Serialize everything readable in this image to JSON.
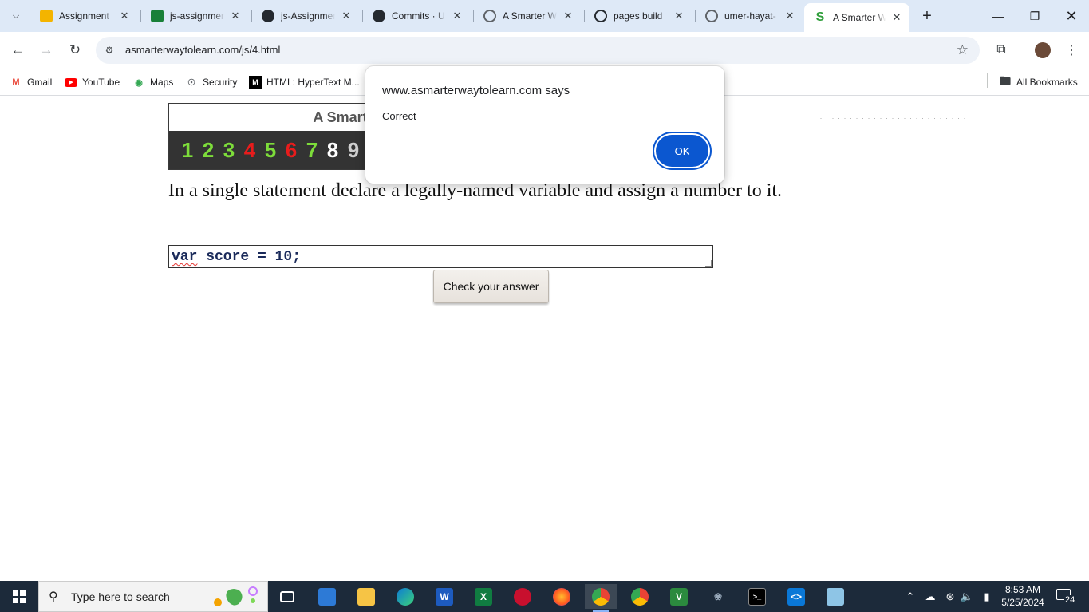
{
  "browser": {
    "tabs": [
      {
        "title": "Assignment",
        "icon": "google-slides-icon",
        "icon_color": "#f4b400",
        "active": false
      },
      {
        "title": "js-assignment",
        "icon": "google-sheets-icon",
        "icon_color": "#188038",
        "active": false
      },
      {
        "title": "js-Assignment",
        "icon": "github-icon",
        "icon_color": "#24292f",
        "active": false
      },
      {
        "title": "Commits · U",
        "icon": "github-icon",
        "icon_color": "#24292f",
        "active": false
      },
      {
        "title": "A Smarter W",
        "icon": "globe-icon",
        "icon_color": "#5f6368",
        "active": false
      },
      {
        "title": "pages build",
        "icon": "github-actions-icon",
        "icon_color": "#24292f",
        "active": false
      },
      {
        "title": "umer-hayat-",
        "icon": "globe-icon",
        "icon_color": "#5f6368",
        "active": false
      },
      {
        "title": "A Smarter W",
        "icon": "s-logo-icon",
        "icon_color": "#2e9e3a",
        "active": true
      }
    ],
    "address": "asmarterwaytolearn.com/js/4.html",
    "bookmarks": [
      {
        "label": "Gmail",
        "icon": "gmail-icon"
      },
      {
        "label": "YouTube",
        "icon": "youtube-icon"
      },
      {
        "label": "Maps",
        "icon": "maps-icon"
      },
      {
        "label": "Security",
        "icon": "globe-icon"
      },
      {
        "label": "HTML: HyperText M...",
        "icon": "mdn-icon"
      }
    ],
    "all_bookmarks": "All Bookmarks"
  },
  "page": {
    "site_title": "A Smarter W",
    "numbers": [
      {
        "n": "1",
        "color": "#7ddc3a"
      },
      {
        "n": "2",
        "color": "#7ddc3a"
      },
      {
        "n": "3",
        "color": "#7ddc3a"
      },
      {
        "n": "4",
        "color": "#e81c1c"
      },
      {
        "n": "5",
        "color": "#7ddc3a"
      },
      {
        "n": "6",
        "color": "#e81c1c"
      },
      {
        "n": "7",
        "color": "#7ddc3a"
      },
      {
        "n": "8",
        "color": "#ffffff"
      },
      {
        "n": "9",
        "color": "#cfcfcf"
      }
    ],
    "instruction": "In a single statement declare a legally-named variable and assign a number to it.",
    "answer_keyword": "var",
    "answer_rest": " score = 10;",
    "check_button": "Check your answer"
  },
  "dialog": {
    "title": "www.asmarterwaytolearn.com says",
    "message": "Correct",
    "ok": "OK"
  },
  "taskbar": {
    "search_placeholder": "Type here to search",
    "time": "8:53 AM",
    "date": "5/25/2024",
    "notifications": "24"
  }
}
